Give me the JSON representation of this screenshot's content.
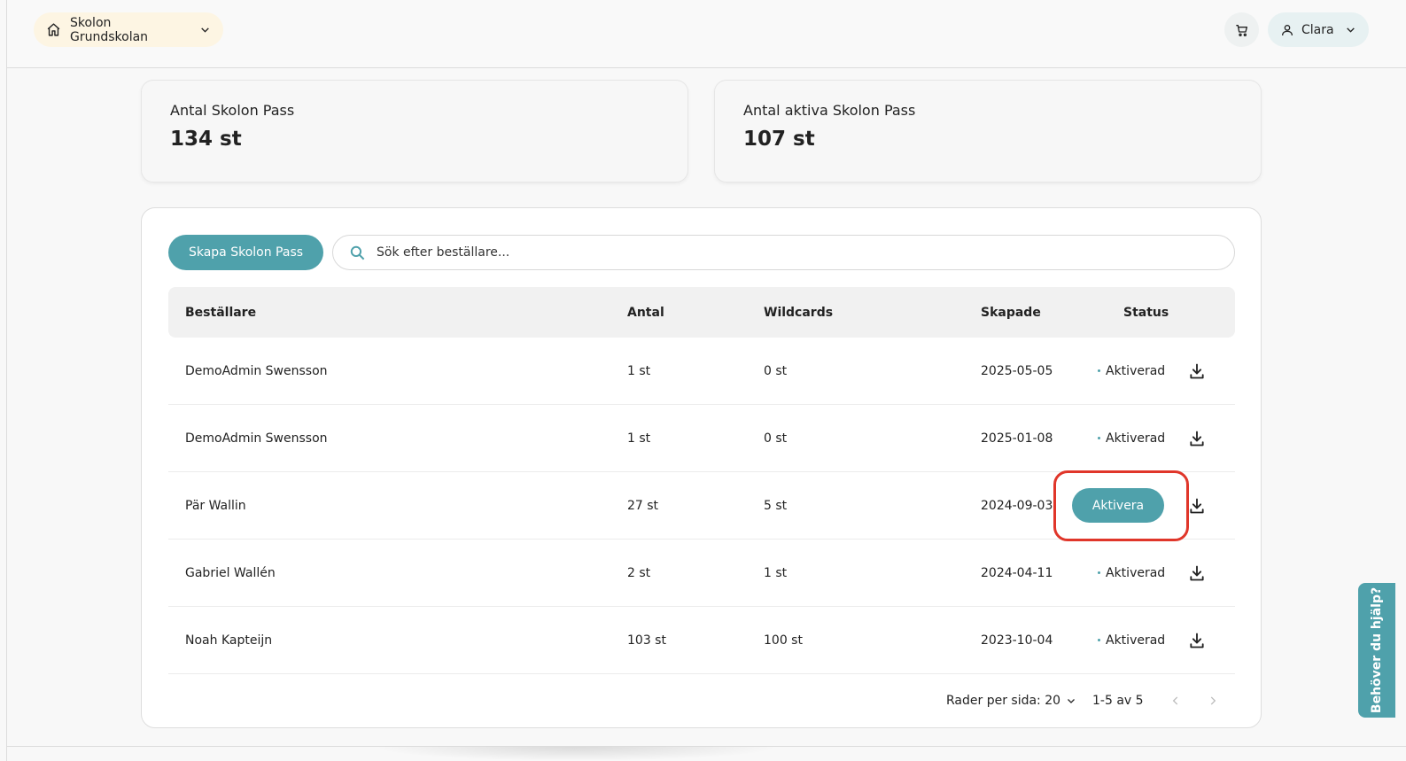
{
  "header": {
    "school_name": "Skolon Grundskolan",
    "user_name": "Clara"
  },
  "stats": [
    {
      "label": "Antal Skolon Pass",
      "value": "134 st"
    },
    {
      "label": "Antal aktiva Skolon Pass",
      "value": "107 st"
    }
  ],
  "toolbar": {
    "create_label": "Skapa Skolon Pass",
    "search_placeholder": "Sök efter beställare..."
  },
  "table": {
    "columns": [
      "Beställare",
      "Antal",
      "Wildcards",
      "Skapade",
      "Status"
    ],
    "rows": [
      {
        "orderer": "DemoAdmin Swensson",
        "count": "1 st",
        "wildcards": "0 st",
        "created": "2025-05-05",
        "status": "Aktiverad"
      },
      {
        "orderer": "DemoAdmin Swensson",
        "count": "1 st",
        "wildcards": "0 st",
        "created": "2025-01-08",
        "status": "Aktiverad"
      },
      {
        "orderer": "Pär Wallin",
        "count": "27 st",
        "wildcards": "5 st",
        "created": "2024-09-03",
        "action_label": "Aktivera"
      },
      {
        "orderer": "Gabriel Wallén",
        "count": "2 st",
        "wildcards": "1 st",
        "created": "2024-04-11",
        "status": "Aktiverad"
      },
      {
        "orderer": "Noah Kapteijn",
        "count": "103 st",
        "wildcards": "100 st",
        "created": "2023-10-04",
        "status": "Aktiverad"
      }
    ]
  },
  "pagination": {
    "rows_per_page_label": "Rader per sida: 20",
    "range_label": "1-5 av 5"
  },
  "help": {
    "label": "Behöver du hjälp?"
  },
  "colors": {
    "accent": "#4fa1ab",
    "highlight": "#e0362a",
    "school_pill_bg": "#fdf5e3",
    "user_pill_bg": "#e7f1f2"
  }
}
